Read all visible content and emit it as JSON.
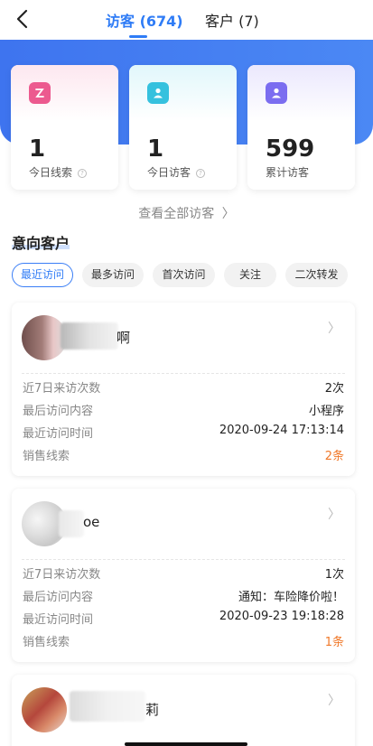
{
  "header": {
    "tabs": [
      {
        "label": "访客 (674)",
        "active": true
      },
      {
        "label": "客户 (7)",
        "active": false
      }
    ],
    "accent_color": "#2f7cf6"
  },
  "stats": [
    {
      "value": "1",
      "label": "今日线索",
      "icon": "lead-icon",
      "color": "#ec5a8f"
    },
    {
      "value": "1",
      "label": "今日访客",
      "icon": "user-icon",
      "color": "#35c1de"
    },
    {
      "value": "599",
      "label": "累计访客",
      "icon": "user-group-icon",
      "color": "#7b6df0"
    }
  ],
  "view_all_label": "查看全部访客",
  "section_title": "意向客户",
  "filters": [
    {
      "label": "最近访问",
      "active": true
    },
    {
      "label": "最多访问",
      "active": false
    },
    {
      "label": "首次访问",
      "active": false
    },
    {
      "label": "关注",
      "active": false
    },
    {
      "label": "二次转发",
      "active": false
    }
  ],
  "visitors": [
    {
      "name_visible": "啊",
      "rows": [
        {
          "label": "近7日来访次数",
          "value": "2次"
        },
        {
          "label": "最后访问内容",
          "value": "小程序"
        },
        {
          "label": "最近访问时间",
          "value": "2020-09-24 17:13:14"
        },
        {
          "label": "销售线索",
          "value": "2条"
        }
      ]
    },
    {
      "name_visible": "oe",
      "rows": [
        {
          "label": "近7日来访次数",
          "value": "1次"
        },
        {
          "label": "最后访问内容",
          "value": "通知：车险降价啦！"
        },
        {
          "label": "最近访问时间",
          "value": "2020-09-23 19:18:28"
        },
        {
          "label": "销售线索",
          "value": "1条"
        }
      ]
    },
    {
      "name_visible": "莉"
    }
  ]
}
